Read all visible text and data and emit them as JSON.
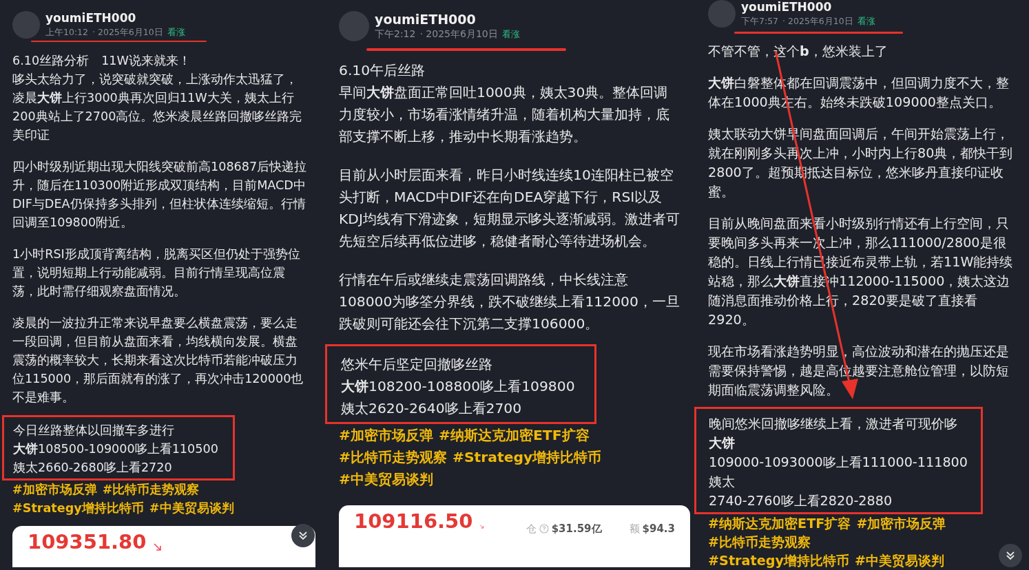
{
  "posts": [
    {
      "header": {
        "username": "youmiETH000",
        "time": "上午10:12",
        "date": "· 2025年6月10日",
        "sentiment": {
          "label": "看涨",
          "kind": "bullish"
        },
        "underlined": true
      },
      "title": "6.10丝路分析　11W说来就来！",
      "paragraphs": [
        "哆头太给力了，说突破就突破，上涨动作太迅猛了，凌晨**大饼**上行3000典再次回归11W大关，姨太上行200典站上了2700高位。悠米凌晨丝路回撤哆丝路完美印证",
        "四小时级别近期出现大阳线突破前高108687后快递拉升，随后在110300附近形成双顶结构，目前MACD中DIF与DEA仍保持多头排列，但柱状体连续缩短。行情回调至109800附近。",
        "1小时RSI形成顶背离结构，脱离买区但仍处于强势位置，说明短期上行动能减弱。目前行情呈现高位震荡，此时需仔细观察盘面情况。",
        "凌晨的一波拉升正常来说早盘要么横盘震荡，要么走一段回调，但目前从盘面来看，均线横向发展。横盘震荡的概率较大，长期来看这次比特币若能冲破压力位115000，那后面就有的涨了，再次冲击120000也不是难事。"
      ],
      "signal": {
        "boxed": true,
        "lines": [
          "今日丝路整体以回撤车多进行",
          "**大饼**108500-109000哆上看110500",
          "姨太2660-2680哆上看2720"
        ]
      },
      "hashtags": [
        "#加密市场反弹",
        "#比特币走势观察",
        "#Strategy增持比特币",
        "#中美贸易谈判"
      ],
      "price_card": {
        "price": "109351.80",
        "falling": true
      },
      "arrow": false,
      "scroll_down_button": true
    },
    {
      "header": {
        "username": "youmiETH000",
        "time": "下午2:12",
        "date": "· 2025年6月10日",
        "sentiment": {
          "label": "看涨",
          "kind": "bullish"
        },
        "underlined": true
      },
      "title": "6.10午后丝路",
      "paragraphs": [
        "早间**大饼**盘面正常回吐1000典，姨太30典。整体回调力度较小，市场看涨情绪升温，随着机构大量加持，底部支撑不断上移，推动中长期看涨趋势。",
        "目前从小时层面来看，昨日小时线连续10连阳柱已被空头打断，MACD中DIF还在向DEA穿越下行，RSI以及KDJ均线有下滑迹象，短期显示哆头逐渐减弱。激进者可先短空后续再低位进哆，稳健者耐心等待进场机会。",
        "行情在午后或继续走震荡回调路线，中长线注意108000为哆筌分界线，跌不破继续上看112000，一旦跌破则可能还会往下沉第二支撑106000。"
      ],
      "signal": {
        "boxed": true,
        "lines": [
          "悠米午后坚定回撤哆丝路",
          "**大饼**108200-108800哆上看109800",
          "姨太2620-2640哆上看2700"
        ]
      },
      "hashtags": [
        "#加密市场反弹",
        "#纳斯达克加密ETF扩容",
        "#比特币走势观察",
        "#Strategy增持比特币",
        "#中美贸易谈判"
      ],
      "price_card": {
        "price": "109116.50",
        "falling": true,
        "stats": [
          {
            "label": "仓",
            "value": "$31.59亿",
            "info": true
          },
          {
            "label": "额",
            "value": "$94.3",
            "info": false
          }
        ]
      },
      "arrow": false,
      "scroll_down_button": false
    },
    {
      "header": {
        "username": "youmiETH000",
        "time": "下午7:57",
        "date": "· 2025年6月10日",
        "sentiment": {
          "label": "看涨",
          "kind": "bullish"
        },
        "underlined": true
      },
      "paragraphs": [
        "不管不管，这个**b**，悠米装上了",
        "**大饼**白磐整体都在回调震荡中，但回调力度不大，整体在1000典左右。始终未跌破109000整点关口。",
        "姨太联动大饼早间盘面回调后，午间开始震荡上行，就在刚刚多头再次上冲，小时内上行80典，都快干到2800了。超预期抵达目标位，悠米哆丹直接印证收蜜。",
        "目前从晚间盘面来看小时级别行情还有上行空间，只要晚间多头再来一次上冲，那么111000/2800是很稳的。日线上行情已接近布灵带上轨，若11W能持续站稳，那么**大饼**直接冲112000-115000，姨太这边随消息面推动价格上行，2820要是破了直接看2920。",
        "现在市场看涨趋势明显，高位波动和潜在的抛压还是需要保持警惕，越是高位越要注意舱位管理，以防短期面临震荡调整风险。"
      ],
      "signal": {
        "boxed": true,
        "lines": [
          "晚间悠米回撤哆继续上看，激进者可现价哆",
          "**大饼**",
          "109000-1093000哆上看111000-111800",
          "姨太",
          "2740-2760哆上看2820-2880"
        ]
      },
      "hashtags": [
        "#纳斯达克加密ETF扩容",
        "#加密市场反弹",
        "#比特币走势观察",
        "#Strategy增持比特币",
        "#中美贸易谈判"
      ],
      "arrow": true,
      "scroll_down_button": true
    }
  ]
}
